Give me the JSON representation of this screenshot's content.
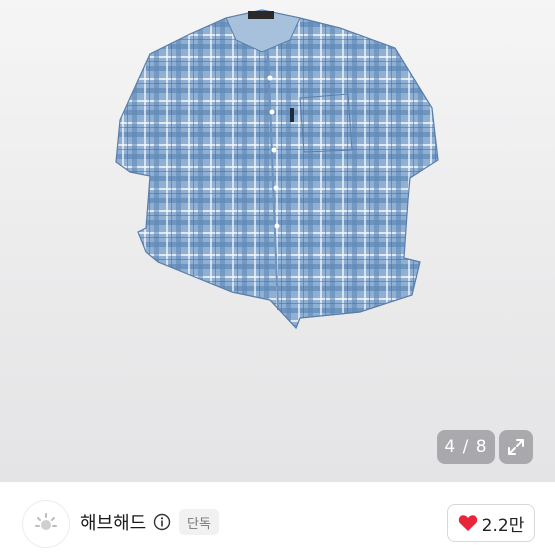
{
  "gallery": {
    "counter": "4 / 8",
    "image_alt": "blue plaid short-sleeve shirt"
  },
  "seller": {
    "name": "해브해드",
    "badge": "단독",
    "like_count": "2.2만"
  },
  "colors": {
    "accent_heart": "#e8253a",
    "shirt_blue": "#7fa3c8"
  }
}
